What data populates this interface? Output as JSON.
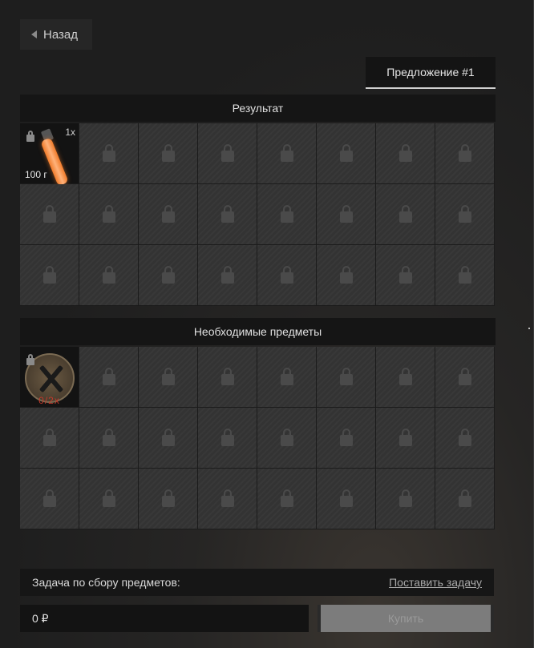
{
  "header": {
    "back_label": "Назад",
    "offer_tab_label": "Предложение #1"
  },
  "result": {
    "title": "Результат",
    "item": {
      "count": "1x",
      "weight": "100 г"
    }
  },
  "required": {
    "title": "Необходимые предметы",
    "item": {
      "need": "0/2x"
    }
  },
  "footer": {
    "task_label": "Задача по сбору предметов:",
    "task_link": "Поставить задачу",
    "price": "0 ₽",
    "buy_label": "Купить"
  },
  "icons": [
    "back-arrow-icon",
    "lock-icon",
    "glowstick-icon",
    "toolkit-icon"
  ],
  "colors": {
    "accent_red": "#c0392b",
    "glow_orange": "#f07b2a"
  }
}
